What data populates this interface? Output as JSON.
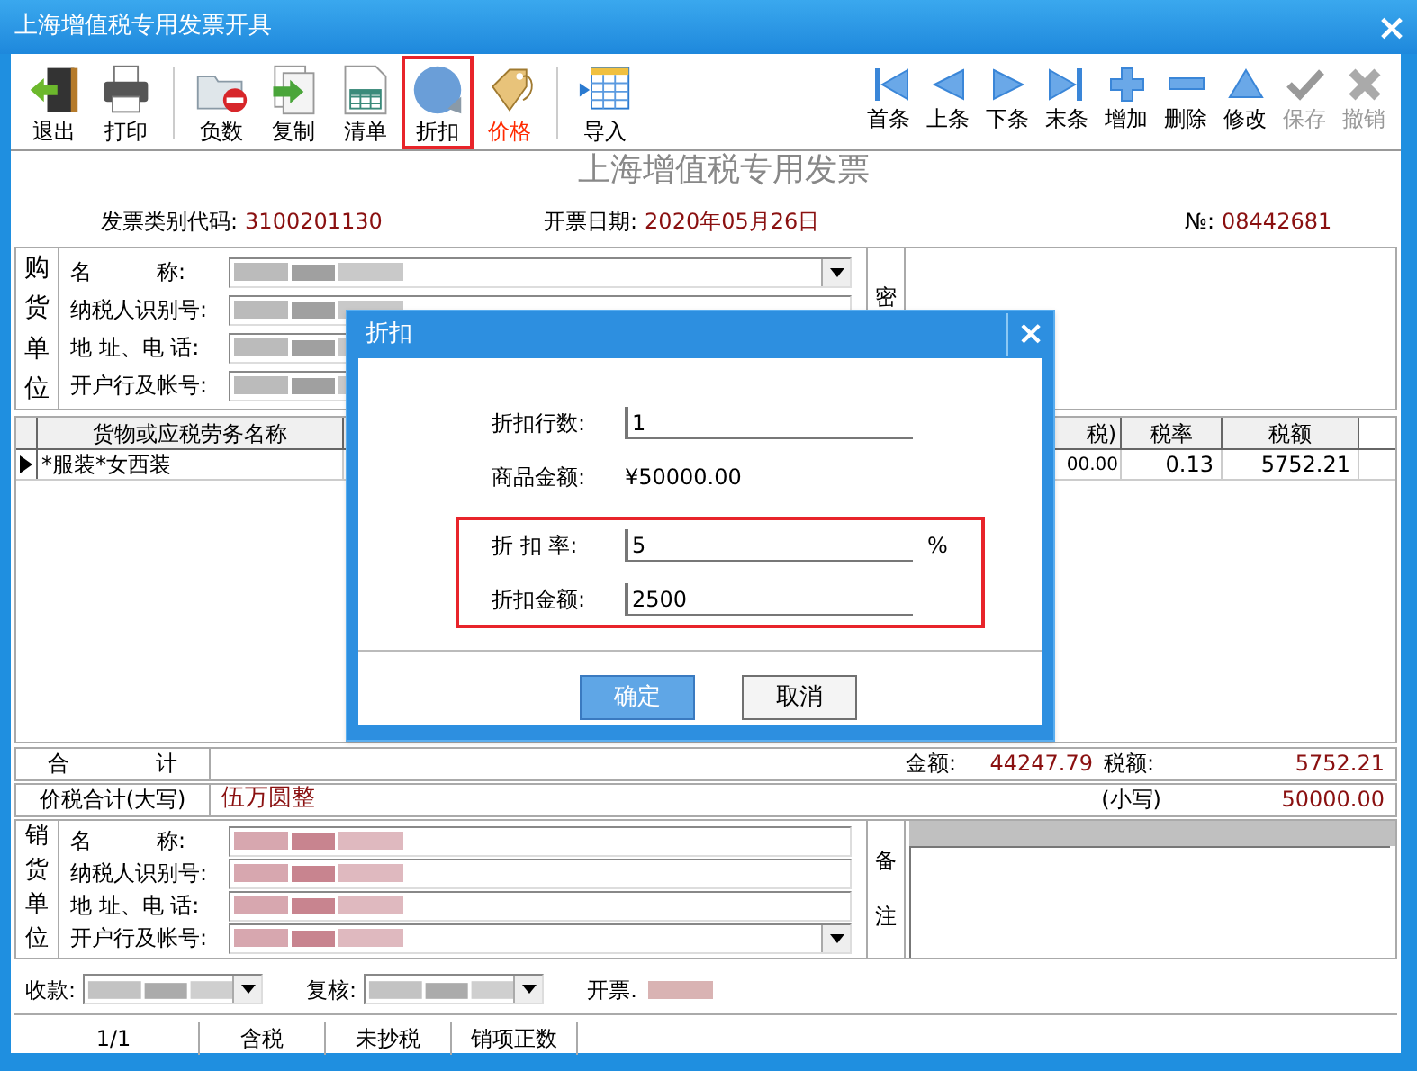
{
  "window": {
    "title": "上海增值税专用发票开具",
    "close": "×"
  },
  "toolbar_groups": [
    [
      {
        "label": "退出",
        "kind": "exit",
        "highlighted": false,
        "color": "#000000"
      },
      {
        "label": "打印",
        "kind": "print",
        "highlighted": false,
        "color": "#000000"
      }
    ],
    [
      {
        "label": "负数",
        "kind": "negative",
        "highlighted": false,
        "color": "#000000"
      },
      {
        "label": "复制",
        "kind": "copy",
        "highlighted": false,
        "color": "#000000"
      },
      {
        "label": "清单",
        "kind": "list",
        "highlighted": false,
        "color": "#000000"
      },
      {
        "label": "折扣",
        "kind": "discount",
        "highlighted": true,
        "color": "#000000"
      },
      {
        "label": "价格",
        "kind": "price",
        "highlighted": false,
        "color": "#ff2a00"
      }
    ],
    [
      {
        "label": "导入",
        "kind": "import",
        "highlighted": false,
        "color": "#000000"
      }
    ]
  ],
  "nav_buttons": [
    {
      "label": "首条",
      "kind": "first",
      "disabled": false
    },
    {
      "label": "上条",
      "kind": "prev",
      "disabled": false
    },
    {
      "label": "下条",
      "kind": "next",
      "disabled": false
    },
    {
      "label": "末条",
      "kind": "last",
      "disabled": false
    },
    {
      "label": "增加",
      "kind": "add",
      "disabled": false
    },
    {
      "label": "删除",
      "kind": "remove",
      "disabled": false
    },
    {
      "label": "修改",
      "kind": "edit",
      "disabled": false
    },
    {
      "label": "保存",
      "kind": "save",
      "disabled": true
    },
    {
      "label": "撤销",
      "kind": "cancel",
      "disabled": true
    }
  ],
  "invoice": {
    "title": "上海增值税专用发票",
    "type_code_label": "发票类别代码:",
    "type_code": "3100201130",
    "date_label": "开票日期:",
    "date": "2020年05月26日",
    "number_label": "№:",
    "number": "08442681"
  },
  "buyer": {
    "side_label": "购货单位",
    "fields": [
      {
        "label": "名　　　称:",
        "kind": "dropdown"
      },
      {
        "label": "纳税人识别号:",
        "kind": "text"
      },
      {
        "label": "地 址、电 话:",
        "kind": "text"
      },
      {
        "label": "开户行及帐号:",
        "kind": "text"
      }
    ],
    "password_label": "密"
  },
  "items_table": {
    "columns": [
      "货物或应税劳务名称",
      "税)",
      "税率",
      "税额"
    ],
    "rows": [
      {
        "selected": true,
        "cells": [
          "*服装*女西装",
          "00.00",
          "0.13",
          "5752.21"
        ]
      }
    ]
  },
  "totals": {
    "label": "合　　　　计",
    "amount_label": "金额:",
    "amount": "44247.79",
    "tax_label": "税额:",
    "tax": "5752.21"
  },
  "grand_total": {
    "label": "价税合计(大写)",
    "words": "伍万圆整",
    "small_label": "(小写)",
    "figure": "50000.00"
  },
  "seller": {
    "side_label": "销货单位",
    "fields": [
      {
        "label": "名　　　称:",
        "kind": "text"
      },
      {
        "label": "纳税人识别号:",
        "kind": "text"
      },
      {
        "label": "地 址、电 话:",
        "kind": "text"
      },
      {
        "label": "开户行及帐号:",
        "kind": "dropdown"
      }
    ],
    "remarks_label": "备注"
  },
  "signers": [
    {
      "label": "收款:",
      "kind": "dropdown"
    },
    {
      "label": "复核:",
      "kind": "dropdown"
    },
    {
      "label": "开票.",
      "kind": "text"
    }
  ],
  "status_bar": [
    "1/1",
    "含税",
    "未抄税",
    "销项正数"
  ],
  "dialog": {
    "title": "折扣",
    "close": "×",
    "fields": [
      {
        "label": "折扣行数:",
        "kind": "input",
        "value": "1",
        "highlighted": false
      },
      {
        "label": "商品金额:",
        "kind": "display",
        "value": "¥50000.00",
        "highlighted": false
      },
      {
        "label": "折 扣 率:",
        "kind": "input",
        "value": "5",
        "unit": "%",
        "highlighted": true
      },
      {
        "label": "折扣金额:",
        "kind": "input",
        "value": "2500",
        "highlighted": true
      }
    ],
    "buttons": [
      {
        "label": "确定",
        "selected": true
      },
      {
        "label": "取消",
        "selected": false
      }
    ]
  }
}
